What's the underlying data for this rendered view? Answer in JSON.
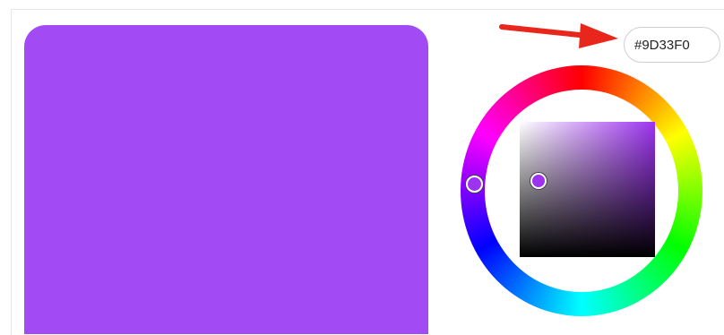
{
  "color_picker": {
    "hex_value": "#9D33F0",
    "selected_color": "#A24AF4",
    "hue_color": "#9D33F0"
  },
  "annotation": {
    "arrow_color": "#E8261C"
  },
  "icons": [
    "arrow-right-icon"
  ]
}
